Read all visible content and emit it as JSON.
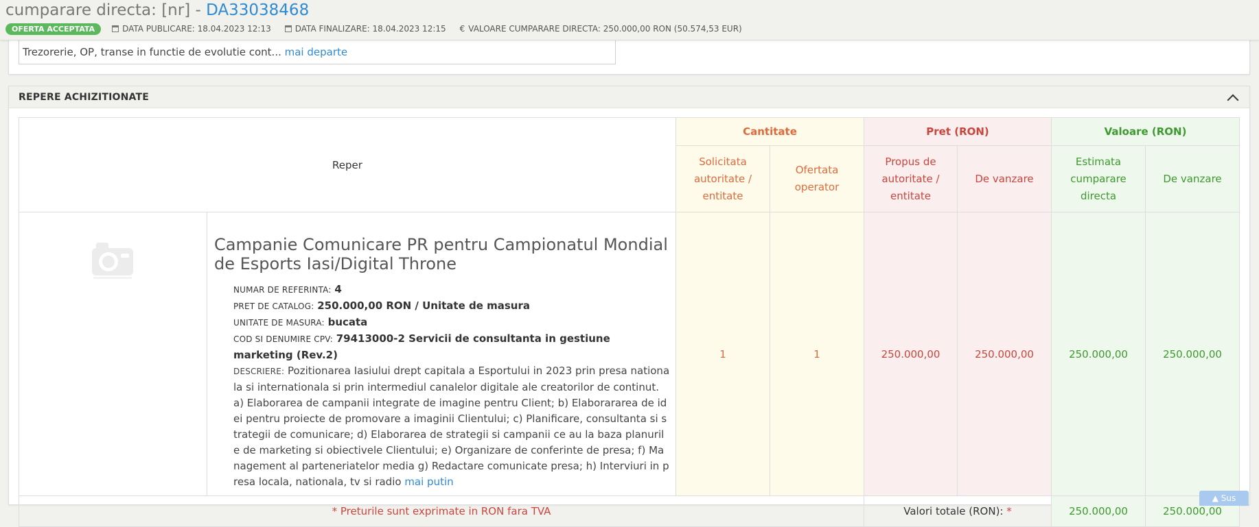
{
  "header": {
    "title_prefix": "cumparare directa: [nr] - ",
    "code": "DA33038468",
    "status_badge": "OFERTA ACCEPTATA",
    "data_publicare": "DATA PUBLICARE: 18.04.2023 12:13",
    "data_finalizare": "DATA FINALIZARE: 18.04.2023 12:15",
    "valoare": "VALOARE CUMPARARE DIRECTA: 250.000,00  RON (50.574,53  EUR)"
  },
  "top_panel": {
    "text": "Trezorerie, OP, transe in functie de evolutie cont... ",
    "more_link": "mai departe"
  },
  "repere": {
    "title": "REPERE ACHIZITIONATE",
    "col_reper": "Reper",
    "group_cantitate": "Cantitate",
    "group_pret": "Pret (RON)",
    "group_valoare": "Valoare (RON)",
    "sub_solicitata": "Solicitata autoritate / entitate",
    "sub_ofertata": "Ofertata operator",
    "sub_propus": "Propus de autoritate / entitate",
    "sub_pret_vanzare": "De vanzare",
    "sub_estimata": "Estimata cumparare directa",
    "sub_val_vanzare": "De vanzare",
    "item": {
      "title": "Campanie Comunicare PR pentru Campionatul Mondial de Esports Iasi/Digital Throne",
      "ref_label": "NUMAR DE REFERINTA:",
      "ref_value": "4",
      "pret_label": "PRET DE CATALOG:",
      "pret_value": "250.000,00  RON / Unitate de masura",
      "um_label": "UNITATE DE MASURA:",
      "um_value": "bucata",
      "cpv_label": "COD SI DENUMIRE CPV:",
      "cpv_value": "79413000-2 Servicii de consultanta in gestiune marketing (Rev.2)",
      "desc_label": "DESCRIERE:",
      "desc_value": "Pozitionarea Iasiului drept capitala a Esportului in 2023 prin presa nationala si internationala si prin intermediul canalelor digitale ale creatorilor de continut. a) Elaborarea de campanii integrate de imagine pentru Client; b) Elaborararea de idei pentru proiecte de promovare a imaginii Clientului; c) Planificare, consultanta si strategii de comunicare; d) Elaborarea de strategii si campanii ce au la baza planurile de marketing si obiectivele Clientului; e) Organizare de conferinte de presa; f) Management al parteneriatelor media g) Redactare comunicate presa; h) Interviuri in presa locala, nationala, tv si radio ",
      "less_link": "mai putin",
      "cant_solicitata": "1",
      "cant_ofertata": "1",
      "pret_propus": "250.000,00",
      "pret_vanzare": "250.000,00",
      "val_estimata": "250.000,00",
      "val_vanzare": "250.000,00"
    },
    "footer_note": "* Preturile sunt exprimate in RON fara TVA",
    "total_label": "Valori totale (RON):",
    "total_asterisk": "*",
    "total_estimata": "250.000,00",
    "total_vanzare": "250.000,00"
  },
  "scroll_top_button": "Sus"
}
